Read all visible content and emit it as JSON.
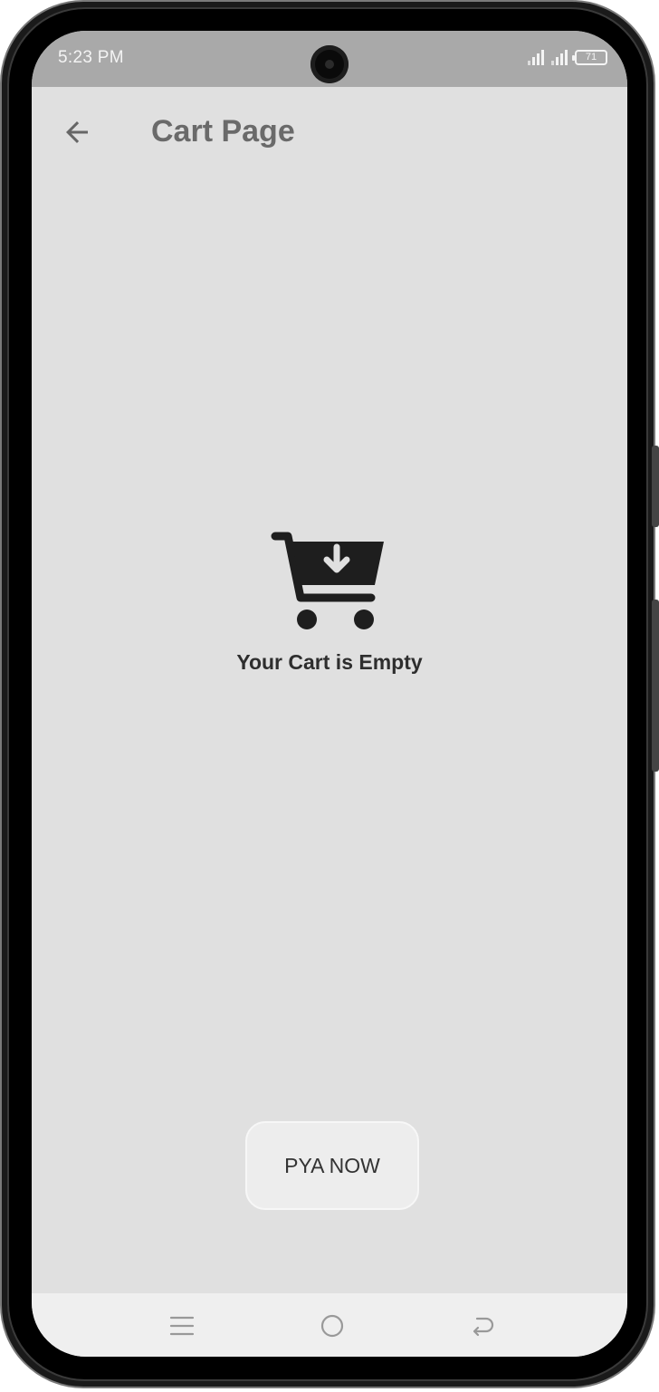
{
  "status_bar": {
    "time": "5:23 PM",
    "battery": "71"
  },
  "app_bar": {
    "title": "Cart Page"
  },
  "empty_state": {
    "message": "Your Cart is Empty"
  },
  "actions": {
    "pay_label": "PYA NOW"
  },
  "icons": {
    "back": "arrow-left-icon",
    "cart": "cart-download-icon",
    "nav_menu": "menu-icon",
    "nav_home": "home-circle-icon",
    "nav_back": "return-icon"
  },
  "colors": {
    "screen_bg": "#e0e0e0",
    "status_bar_bg": "#a9a9a9",
    "title": "#6a6a6a",
    "nav_bar_bg": "#efefef"
  }
}
